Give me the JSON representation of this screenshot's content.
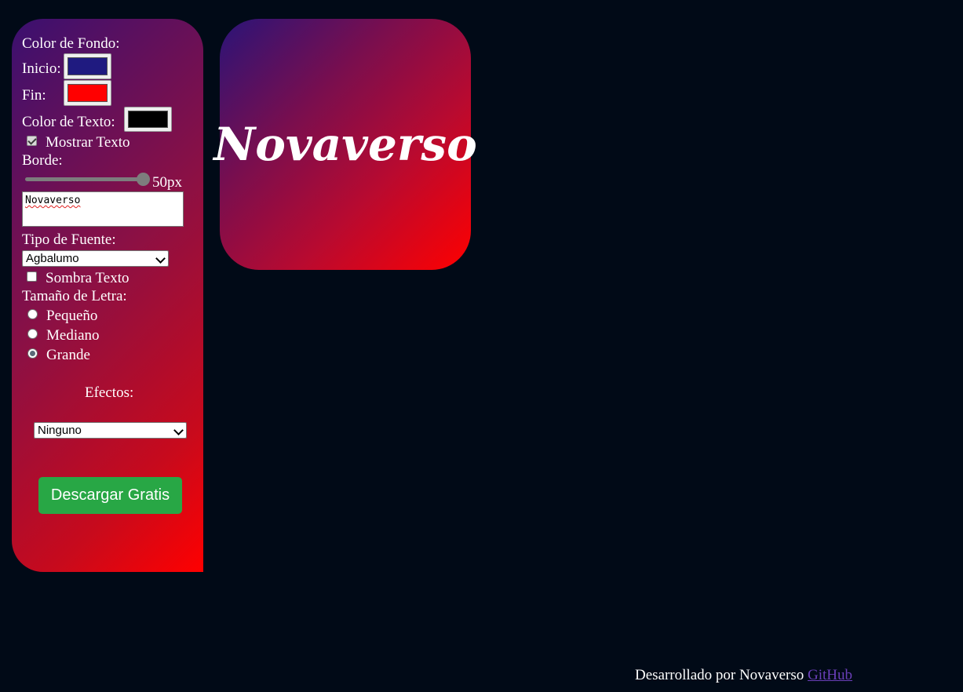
{
  "controls": {
    "bg_color_label": "Color de Fondo:",
    "start_label": "Inicio:",
    "start_color": "#1f1a80",
    "end_label": "Fin:",
    "end_color": "#ff0000",
    "text_color_label": "Color de Texto:",
    "text_color": "#000000",
    "show_text_label": "Mostrar Texto",
    "show_text_checked": true,
    "border_label": "Borde:",
    "border_value": "50px",
    "text_input_value": "Novaverso",
    "font_type_label": "Tipo de Fuente:",
    "font_select_value": "Agbalumo",
    "shadow_label": "Sombra Texto",
    "shadow_checked": false,
    "font_size_label": "Tamaño de Letra:",
    "sizes": [
      {
        "label": "Pequeño",
        "checked": false
      },
      {
        "label": "Mediano",
        "checked": false
      },
      {
        "label": "Grande",
        "checked": true
      }
    ],
    "effects_label": "Efectos:",
    "effects_select_value": "Ninguno",
    "download_button": "Descargar Gratis"
  },
  "preview": {
    "text": "Novaverso"
  },
  "footer": {
    "text": "Desarrollado por Novaverso ",
    "link": "GitHub"
  },
  "colors": {
    "page_bg": "#010a17",
    "button_green": "#28a745",
    "link_purple": "#6a3fb8"
  }
}
